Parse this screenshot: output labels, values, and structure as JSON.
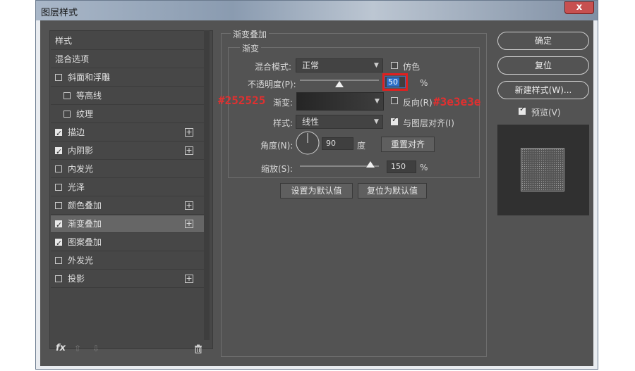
{
  "window": {
    "title": "图层样式",
    "close_label": "x"
  },
  "left_panel": {
    "items": [
      {
        "label": "样式",
        "checkbox": false,
        "checked": false,
        "plus": false,
        "indent": false,
        "selected": false
      },
      {
        "label": "混合选项",
        "checkbox": false,
        "checked": false,
        "plus": false,
        "indent": false,
        "selected": false
      },
      {
        "label": "斜面和浮雕",
        "checkbox": true,
        "checked": false,
        "plus": false,
        "indent": false,
        "selected": false
      },
      {
        "label": "等高线",
        "checkbox": true,
        "checked": false,
        "plus": false,
        "indent": true,
        "selected": false
      },
      {
        "label": "纹理",
        "checkbox": true,
        "checked": false,
        "plus": false,
        "indent": true,
        "selected": false
      },
      {
        "label": "描边",
        "checkbox": true,
        "checked": true,
        "plus": true,
        "indent": false,
        "selected": false
      },
      {
        "label": "内阴影",
        "checkbox": true,
        "checked": true,
        "plus": true,
        "indent": false,
        "selected": false
      },
      {
        "label": "内发光",
        "checkbox": true,
        "checked": false,
        "plus": false,
        "indent": false,
        "selected": false
      },
      {
        "label": "光泽",
        "checkbox": true,
        "checked": false,
        "plus": false,
        "indent": false,
        "selected": false
      },
      {
        "label": "颜色叠加",
        "checkbox": true,
        "checked": false,
        "plus": true,
        "indent": false,
        "selected": false
      },
      {
        "label": "渐变叠加",
        "checkbox": true,
        "checked": true,
        "plus": true,
        "indent": false,
        "selected": true
      },
      {
        "label": "图案叠加",
        "checkbox": true,
        "checked": true,
        "plus": false,
        "indent": false,
        "selected": false
      },
      {
        "label": "外发光",
        "checkbox": true,
        "checked": false,
        "plus": false,
        "indent": false,
        "selected": false
      },
      {
        "label": "投影",
        "checkbox": true,
        "checked": false,
        "plus": true,
        "indent": false,
        "selected": false
      }
    ],
    "footer": {
      "fx_label": "fx",
      "up_icon": "arrow-up-icon",
      "down_icon": "arrow-down-icon",
      "trash_icon": "trash-icon"
    }
  },
  "gradient_overlay": {
    "group_title": "渐变叠加",
    "subgroup_title": "渐变",
    "blend_mode_label": "混合模式:",
    "blend_mode_value": "正常",
    "dither_label": "仿色",
    "dither_checked": false,
    "opacity_label": "不透明度(P):",
    "opacity_value": "50",
    "opacity_unit": "%",
    "opacity_fraction": 0.5,
    "gradient_label": "渐变:",
    "reverse_label": "反向(R)",
    "reverse_checked": false,
    "style_label": "样式:",
    "style_value": "线性",
    "align_label": "与图层对齐(I)",
    "align_checked": true,
    "angle_label": "角度(N):",
    "angle_value": "90",
    "angle_unit": "度",
    "reset_align_label": "重置对齐",
    "scale_label": "缩放(S):",
    "scale_value": "150",
    "scale_unit": "%",
    "scale_fraction": 0.75,
    "set_default_label": "设置为默认值",
    "reset_default_label": "复位为默认值"
  },
  "annotations": {
    "left_color": "#252525",
    "right_color": "#3e3e3e"
  },
  "right_panel": {
    "ok_label": "确定",
    "reset_label": "复位",
    "new_style_label": "新建样式(W)...",
    "preview_label": "预览(V)",
    "preview_checked": true
  },
  "colors": {
    "gradient_start": "#252525",
    "gradient_end": "#3e3e3e",
    "highlight_box": "#e02020"
  }
}
